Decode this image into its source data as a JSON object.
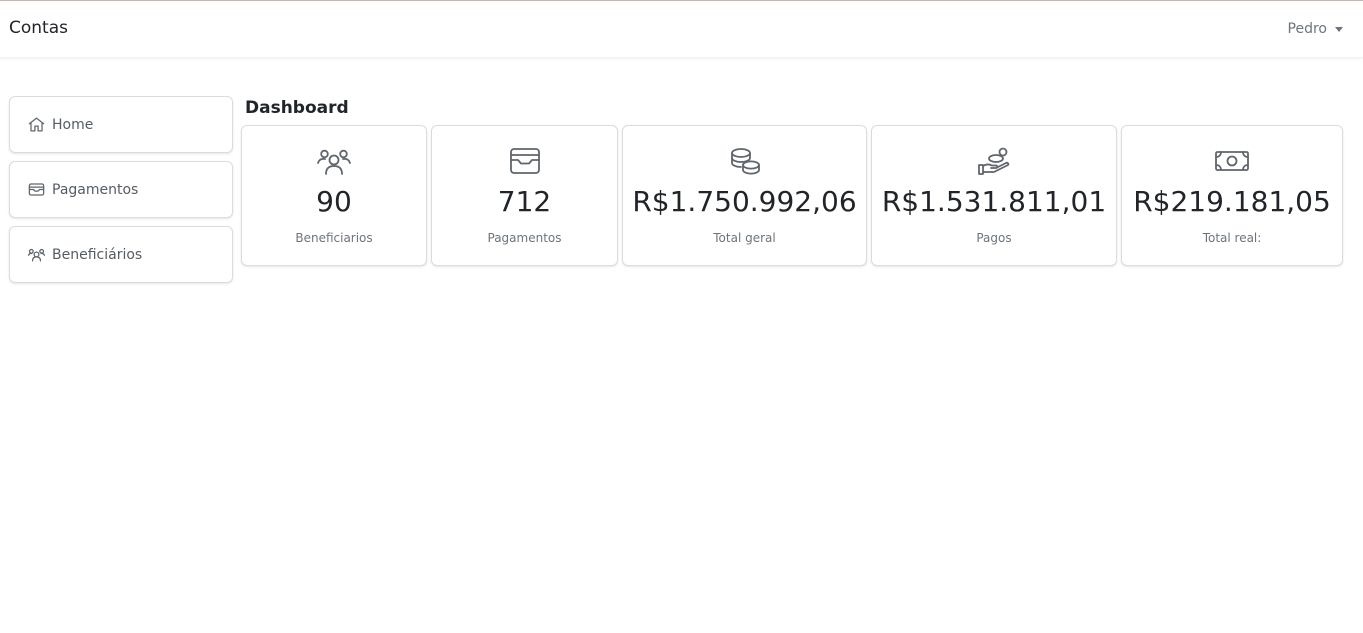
{
  "navbar": {
    "brand": "Contas",
    "user": "Pedro"
  },
  "sidebar": {
    "items": [
      {
        "label": "Home",
        "icon": "home-icon"
      },
      {
        "label": "Pagamentos",
        "icon": "wallet-icon"
      },
      {
        "label": "Beneficiários",
        "icon": "users-icon"
      }
    ]
  },
  "main": {
    "title": "Dashboard",
    "cards": [
      {
        "value": "90",
        "label": "Beneficiarios",
        "icon": "users-icon"
      },
      {
        "value": "712",
        "label": "Pagamentos",
        "icon": "wallet-icon"
      },
      {
        "value": "R$1.750.992,06",
        "label": "Total geral",
        "icon": "coins-icon"
      },
      {
        "value": "R$1.531.811,01",
        "label": "Pagos",
        "icon": "hand-coin-icon"
      },
      {
        "value": "R$219.181,05",
        "label": "Total real:",
        "icon": "cash-icon"
      }
    ]
  },
  "colors": {
    "icon": "#5f666d",
    "muted_text": "#6c757d",
    "border": "#dcdcdc"
  }
}
